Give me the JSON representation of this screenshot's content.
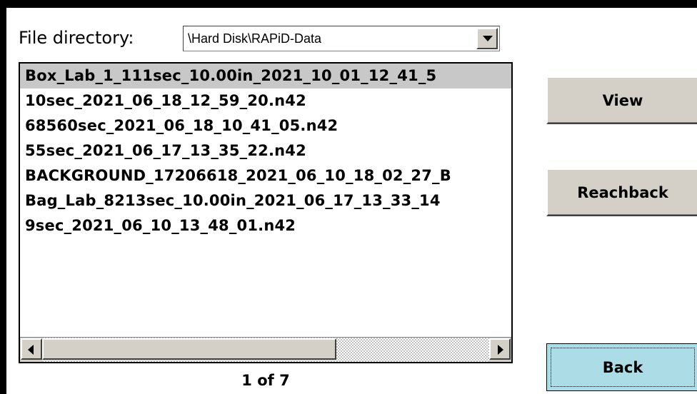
{
  "file_directory": {
    "label": "File directory:",
    "value": "\\Hard Disk\\RAPiD-Data"
  },
  "files": [
    "Box_Lab_1_111sec_10.00in_2021_10_01_12_41_5",
    "10sec_2021_06_18_12_59_20.n42",
    "68560sec_2021_06_18_10_41_05.n42",
    "55sec_2021_06_17_13_35_22.n42",
    "BACKGROUND_17206618_2021_06_10_18_02_27_B",
    "Bag_Lab_8213sec_10.00in_2021_06_17_13_33_14",
    "9sec_2021_06_10_13_48_01.n42"
  ],
  "selected_index": 0,
  "page_indicator": "1 of 7",
  "buttons": {
    "view": "View",
    "reachback": "Reachback",
    "back": "Back"
  }
}
